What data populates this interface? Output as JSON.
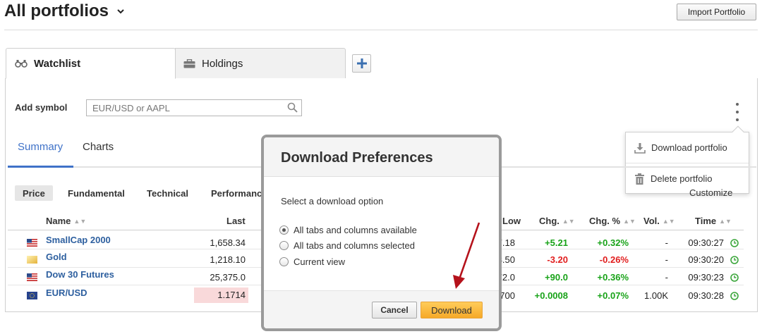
{
  "header": {
    "title": "All portfolios",
    "import_label": "Import Portfolio"
  },
  "tabs": {
    "watchlist": "Watchlist",
    "holdings": "Holdings"
  },
  "symbol": {
    "label": "Add symbol",
    "placeholder": "EUR/USD or AAPL"
  },
  "menu": {
    "download": "Download portfolio",
    "delete": "Delete portfolio"
  },
  "subtabs": {
    "summary": "Summary",
    "charts": "Charts"
  },
  "views": {
    "price": "Price",
    "fundamental": "Fundamental",
    "technical": "Technical",
    "performance": "Performance",
    "customize": "Customize"
  },
  "columns": {
    "name": "Name",
    "last": "Last",
    "low": "Low",
    "chg": "Chg.",
    "chg_pct": "Chg. %",
    "vol": "Vol.",
    "time": "Time"
  },
  "rows": [
    {
      "name": "SmallCap 2000",
      "last": "1,658.34",
      "low": "7.18",
      "chg": "+5.21",
      "chg_pct": "+0.32%",
      "vol": "-",
      "time": "09:30:27",
      "flag": "us"
    },
    {
      "name": "Gold",
      "last": "1,218.10",
      "low": "3.50",
      "chg": "-3.20",
      "chg_pct": "-0.26%",
      "vol": "-",
      "time": "09:30:20",
      "flag": "gold"
    },
    {
      "name": "Dow 30 Futures",
      "last": "25,375.0",
      "low": "72.0",
      "chg": "+90.0",
      "chg_pct": "+0.36%",
      "vol": "-",
      "time": "09:30:23",
      "flag": "us"
    },
    {
      "name": "EUR/USD",
      "last": "1.1714",
      "low": "700",
      "chg": "+0.0008",
      "chg_pct": "+0.07%",
      "vol": "1.00K",
      "time": "09:30:28",
      "flag": "eu"
    }
  ],
  "modal": {
    "title": "Download Preferences",
    "subtitle": "Select a download option",
    "options": [
      "All tabs and columns available",
      "All tabs and columns selected",
      "Current view"
    ],
    "selected_option": "All tabs and columns available",
    "cancel_label": "Cancel",
    "download_label": "Download"
  },
  "colors": {
    "accent": "#3f72c8",
    "positive": "#19a319",
    "negative": "#e11d1d",
    "download_button": "#f6a928",
    "name_link": "#2d5f9f"
  }
}
